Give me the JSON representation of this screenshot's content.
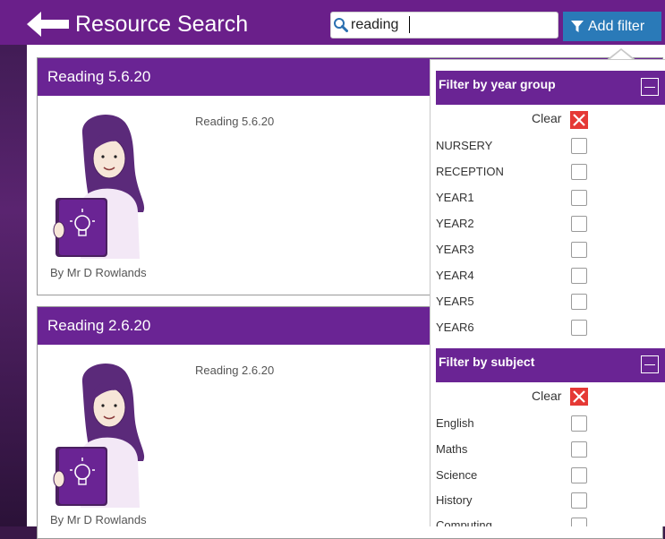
{
  "header": {
    "title": "Resource Search",
    "search_value": "reading",
    "add_filter_label": "Add filter"
  },
  "cards": [
    {
      "title": "Reading 5.6.20",
      "description": "Reading 5.6.20",
      "author": "By Mr D Rowlands"
    },
    {
      "title": "Reading 2.6.20",
      "description": "Reading 2.6.20",
      "author": "By Mr D Rowlands"
    }
  ],
  "filters": {
    "year_group": {
      "title": "Filter by year group",
      "clear_label": "Clear",
      "options": [
        "NURSERY",
        "RECEPTION",
        "YEAR1",
        "YEAR2",
        "YEAR3",
        "YEAR4",
        "YEAR5",
        "YEAR6"
      ]
    },
    "subject": {
      "title": "Filter by subject",
      "clear_label": "Clear",
      "options": [
        "English",
        "Maths",
        "Science",
        "History",
        "Computing"
      ]
    }
  },
  "colors": {
    "header_purple": "#6a1f8a",
    "card_purple": "#6a2494",
    "button_blue": "#2a7ab8",
    "clear_red": "#e53935"
  },
  "icons": [
    "back-arrow-icon",
    "search-icon",
    "funnel-icon",
    "collapse-icon",
    "clear-x-icon",
    "teacher-avatar"
  ]
}
